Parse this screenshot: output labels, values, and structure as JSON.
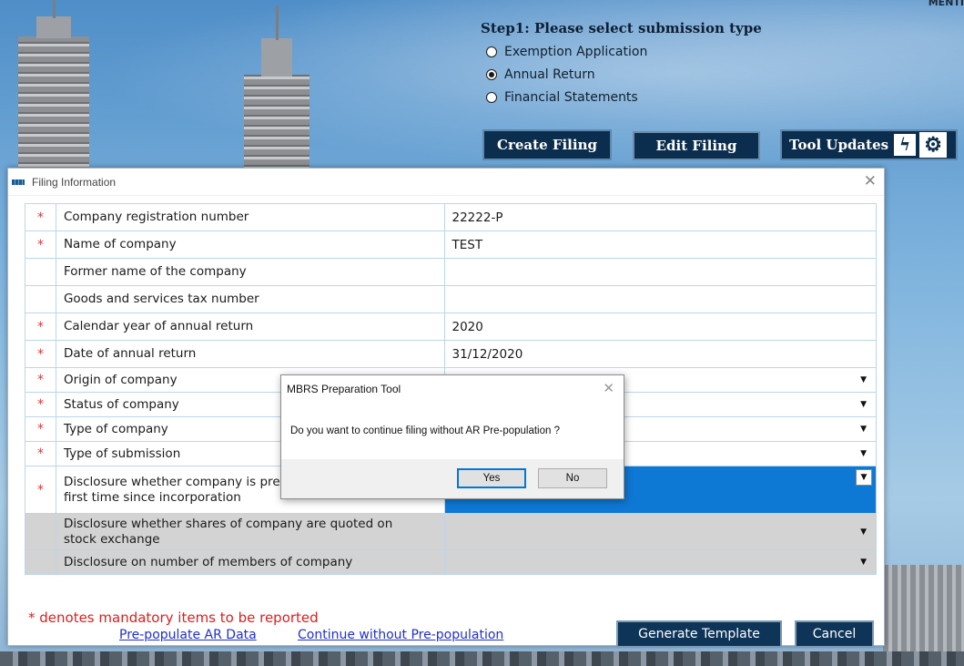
{
  "submission": {
    "step_title": "Step1: Please select submission type",
    "options": [
      {
        "label": "Exemption Application",
        "selected": false
      },
      {
        "label": "Annual Return",
        "selected": true
      },
      {
        "label": "Financial Statements",
        "selected": false
      }
    ],
    "create_filing_label": "Create Filing",
    "edit_filing_label": "Edit Filing",
    "tool_updates_label": "Tool Updates",
    "corner_text": "MENTI"
  },
  "filing_window": {
    "title": "Filing Information",
    "close_glyph": "✕",
    "mandatory_star": "*",
    "rows": [
      {
        "label": "Company registration number",
        "value": "22222-P",
        "mandatory": true
      },
      {
        "label": "Name of company",
        "value": "TEST",
        "mandatory": true
      },
      {
        "label": "Former name of the company",
        "value": "",
        "mandatory": false
      },
      {
        "label": "Goods and services tax number",
        "value": "",
        "mandatory": false
      },
      {
        "label": "Calendar year of annual return",
        "value": "2020",
        "mandatory": true
      },
      {
        "label": "Date of annual return",
        "value": "31/12/2020",
        "mandatory": true
      },
      {
        "label": "Origin of company",
        "value": "",
        "mandatory": true
      },
      {
        "label": "Status of company",
        "value": "",
        "mandatory": true
      },
      {
        "label": "Type of company",
        "value": "",
        "mandatory": true
      },
      {
        "label": "Type of submission",
        "value": "",
        "mandatory": true
      },
      {
        "label": "Disclosure whether company is pre",
        "label_line2": "first time since incorporation",
        "value": "",
        "mandatory": true
      },
      {
        "label": "Disclosure whether shares of company are quoted on",
        "label_line2": "stock exchange",
        "value": "",
        "mandatory": false
      },
      {
        "label": "Disclosure on number of members of company",
        "value": "",
        "mandatory": false
      }
    ],
    "mandatory_note": "* denotes mandatory items to be reported",
    "prepopulate_link": "Pre-populate AR Data",
    "continue_link": "Continue without Pre-population",
    "generate_label": "Generate Template",
    "cancel_label": "Cancel"
  },
  "dialog": {
    "title": "MBRS Preparation Tool",
    "message": "Do you want to continue filing without AR Pre-population ?",
    "yes_label": "Yes",
    "no_label": "No",
    "close_glyph": "✕"
  },
  "icons": {
    "dropdown_arrow": "▼",
    "bolt": "ϟ",
    "gear": "⚙"
  },
  "colors": {
    "dark_button": "#0c2e4e",
    "selected_row": "#0e78d5",
    "mandatory_red": "#e21c1c",
    "link_blue": "#1f2fd0"
  }
}
